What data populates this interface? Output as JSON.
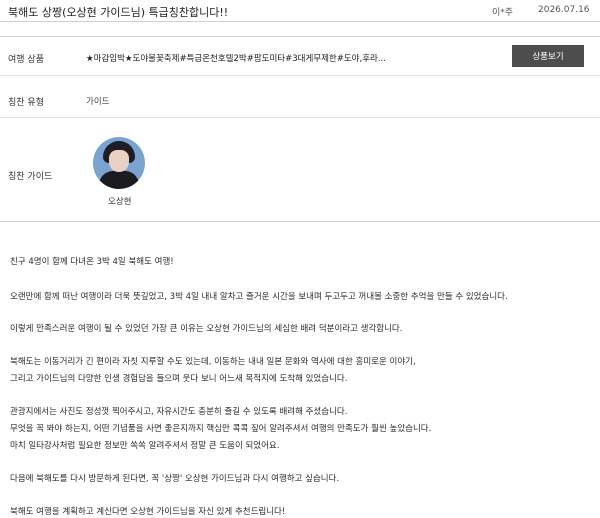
{
  "header": {
    "title": "북해도 상짱(오상현 가이드님) 특급칭찬합니다!!",
    "author": "이*주",
    "date": "2026.07.16"
  },
  "info": {
    "product_label": "여행 상품",
    "product_value": "★마감임박★도야불꽃축제#특급온천호텔2박#팜도미타#3대게무제한#도야,후라...",
    "view_button_label": "상품보기",
    "type_label": "칭찬 유형",
    "type_value": "가이드",
    "guide_label": "칭찬 가이드",
    "guide_name": "오상현"
  },
  "review": {
    "paragraphs": [
      "친구 4명이 함께 다녀온 3박 4일 북해도 여행!",
      "오랜만에 함께 떠난 여행이라 더욱 뜻깊었고, 3박 4일 내내 알차고 즐거운 시간을 보내며 두고두고 꺼내볼 소중한 추억을 만들 수 있었습니다.",
      "이렇게 만족스러운 여행이 될 수 있었던 가장 큰 이유는 오상현 가이드님의 세심한 배려 덕분이라고 생각합니다.",
      "북해도는 이동거리가 긴 편이라 자칫 지루할 수도 있는데, 이동하는 내내 일본 문화와 역사에 대한 흥미로운 이야기,",
      "그리고 가이드님의 다양한 인생 경험담을 들으며 웃다 보니 어느새 목적지에 도착해 있었습니다.",
      "관광지에서는 사진도 정성껏 찍어주시고, 자유시간도 충분히 즐길 수 있도록 배려해 주셨습니다.",
      "무엇을 꼭 봐야 하는지, 어떤 기념품을 사면 좋은지까지 핵심만 콕콕 짚어 알려주셔서 여행의 만족도가 훨씬 높았습니다.",
      "마치 일타강사처럼 필요한 정보만 쏙쏙 알려주셔서 정말 큰 도움이 되었어요.",
      "다음에 북해도를 다시 방문하게 된다면, 꼭 '상짱' 오상현 가이드님과 다시 여행하고 싶습니다.",
      "북해도 여행을 계획하고 계신다면 오상현 가이드님을 자신 있게 추천드립니다!"
    ]
  }
}
